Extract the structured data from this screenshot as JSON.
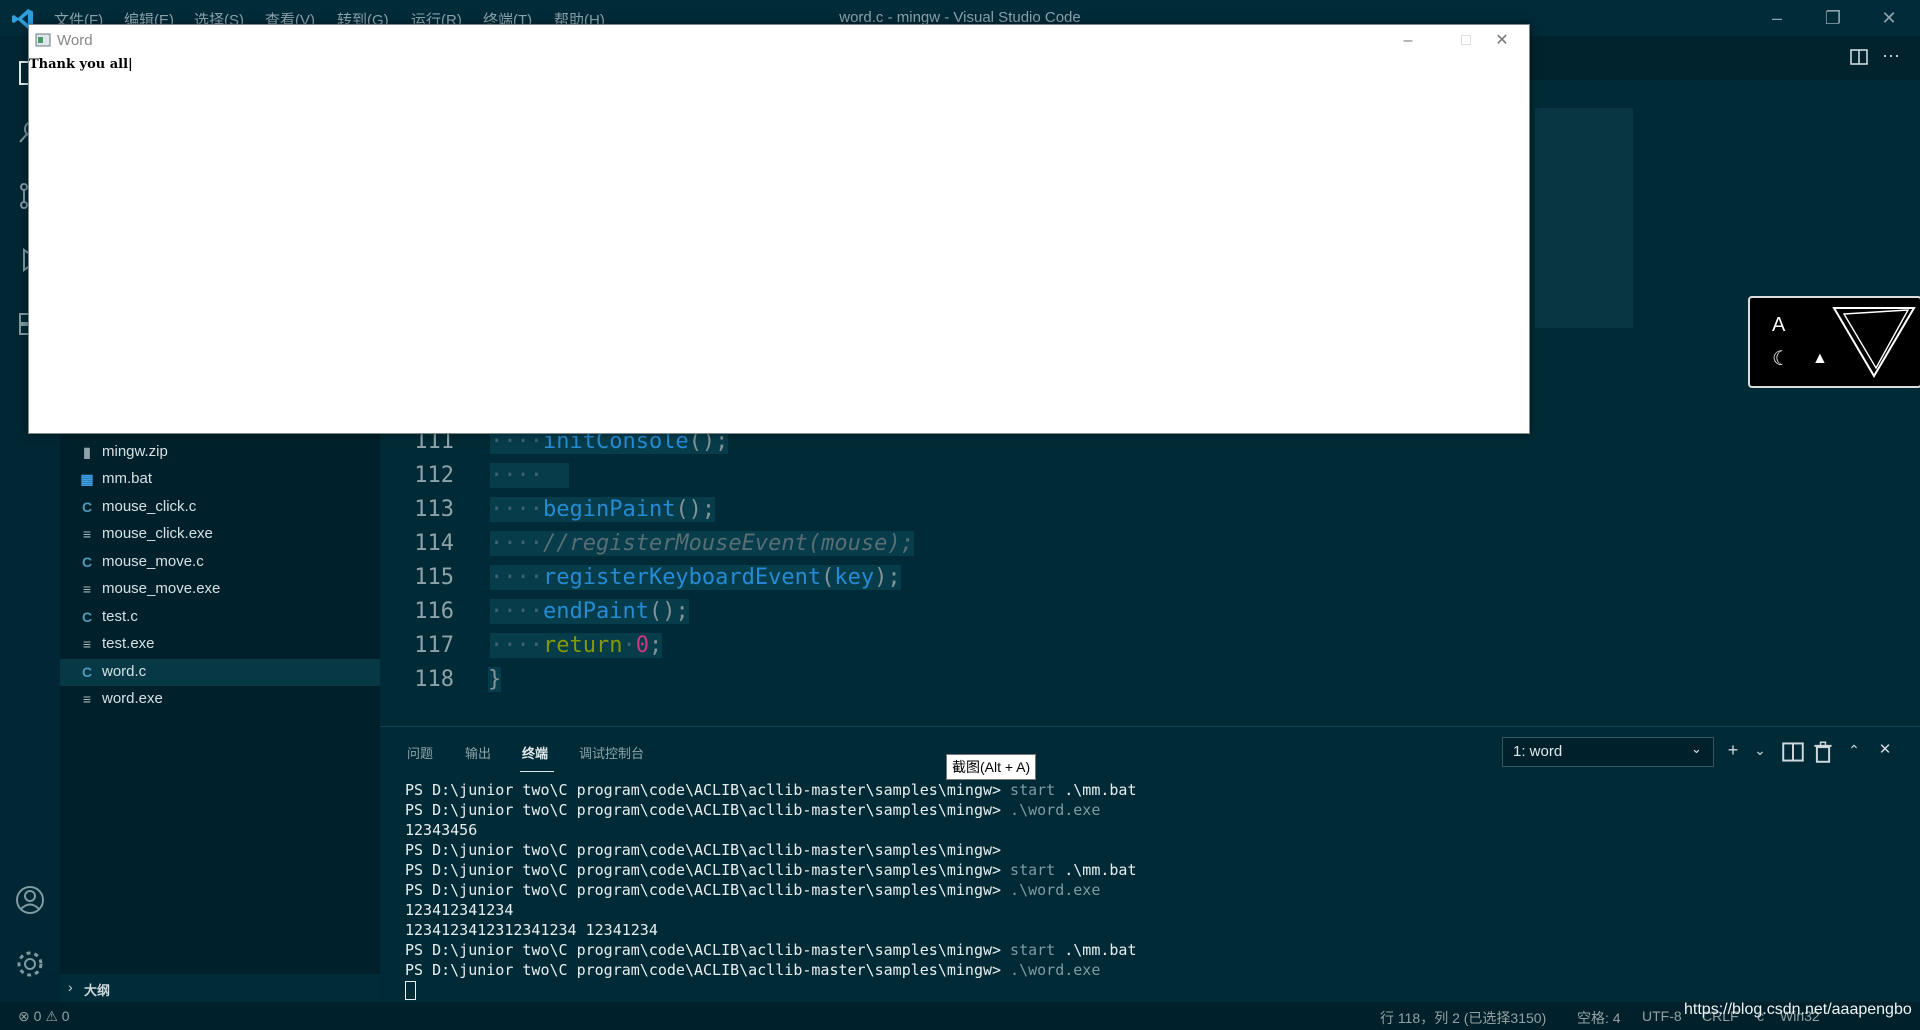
{
  "menu": [
    "文件(F)",
    "编辑(E)",
    "选择(S)",
    "查看(V)",
    "转到(G)",
    "运行(R)",
    "终端(T)",
    "帮助(H)"
  ],
  "window_title": "word.c - mingw - Visual Studio Code",
  "files": [
    {
      "name": "mingw.zip",
      "icon": "zip"
    },
    {
      "name": "mm.bat",
      "icon": "bat"
    },
    {
      "name": "mouse_click.c",
      "icon": "c"
    },
    {
      "name": "mouse_click.exe",
      "icon": "exe"
    },
    {
      "name": "mouse_move.c",
      "icon": "c"
    },
    {
      "name": "mouse_move.exe",
      "icon": "exe"
    },
    {
      "name": "test.c",
      "icon": "c"
    },
    {
      "name": "test.exe",
      "icon": "exe"
    },
    {
      "name": "word.c",
      "icon": "c",
      "active": true
    },
    {
      "name": "word.exe",
      "icon": "exe"
    }
  ],
  "outline_label": "大纲",
  "code": {
    "line_numbers": [
      "111",
      "112",
      "113",
      "114",
      "115",
      "116",
      "117",
      "118"
    ],
    "lines": [
      {
        "dots": "····",
        "fn": "initConsole",
        "rest": "();"
      },
      {
        "dots": "····",
        "fn": "",
        "rest": ""
      },
      {
        "dots": "····",
        "fn": "beginPaint",
        "rest": "();"
      },
      {
        "dots": "····",
        "comment": "//registerMouseEvent(mouse);"
      },
      {
        "dots": "····",
        "fn": "registerKeyboardEvent",
        "arg": "key",
        "rest": ");"
      },
      {
        "dots": "····",
        "fn": "endPaint",
        "rest": "();"
      },
      {
        "dots": "····",
        "kw": "return",
        "num": "0",
        "rest": ";"
      },
      {
        "dots": "",
        "brace": "}"
      }
    ]
  },
  "panel": {
    "tabs": [
      "问题",
      "输出",
      "终端",
      "调试控制台"
    ],
    "active_tab": 2,
    "terminal_select": "1: word"
  },
  "terminal": [
    {
      "prompt": "PS D:\\junior two\\C program\\code\\ACLIB\\acllib-master\\samples\\mingw>",
      "cmd1": " start",
      "cmd2": " .\\mm.bat"
    },
    {
      "prompt": "PS D:\\junior two\\C program\\code\\ACLIB\\acllib-master\\samples\\mingw>",
      "dim": " .\\word.exe"
    },
    {
      "text": "12343456"
    },
    {
      "prompt": "PS D:\\junior two\\C program\\code\\ACLIB\\acllib-master\\samples\\mingw>"
    },
    {
      "prompt": "PS D:\\junior two\\C program\\code\\ACLIB\\acllib-master\\samples\\mingw>",
      "cmd1": " start",
      "cmd2": " .\\mm.bat"
    },
    {
      "prompt": "PS D:\\junior two\\C program\\code\\ACLIB\\acllib-master\\samples\\mingw>",
      "dim": " .\\word.exe"
    },
    {
      "text": "123412341234"
    },
    {
      "text": "1234123412312341234 12341234"
    },
    {
      "prompt": "PS D:\\junior two\\C program\\code\\ACLIB\\acllib-master\\samples\\mingw>",
      "cmd1": " start",
      "cmd2": " .\\mm.bat"
    },
    {
      "prompt": "PS D:\\junior two\\C program\\code\\ACLIB\\acllib-master\\samples\\mingw>",
      "dim": " .\\word.exe"
    }
  ],
  "tooltip": "截图(Alt + A)",
  "word_window": {
    "title": "Word",
    "text": "Thank you all|"
  },
  "widget": {
    "letter": "A"
  },
  "status": {
    "errors": "0",
    "warnings": "0",
    "position": "行 118，列 2 (已选择3150)",
    "spaces": "空格: 4",
    "encoding": "UTF-8",
    "eol": "CRLF",
    "lang_partial": "c",
    "platform": "Win32",
    "watermark": "https://blog.csdn.net/aaapengbo"
  },
  "colors": {
    "bg": "#00303f",
    "function": "#268bd2",
    "keyword": "#859900",
    "number": "#d33682",
    "comment": "#586e75"
  }
}
